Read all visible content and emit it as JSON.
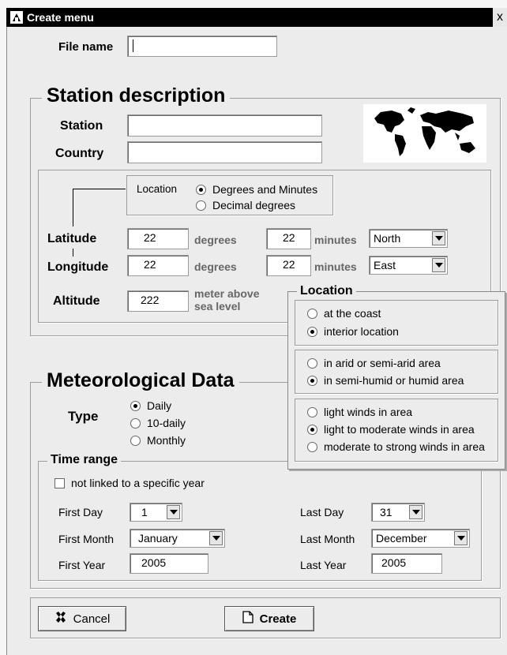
{
  "window": {
    "title": "Create menu",
    "close_label": "x"
  },
  "file": {
    "label": "File name",
    "value": ""
  },
  "station": {
    "heading": "Station description",
    "station_label": "Station",
    "station_value": "",
    "country_label": "Country",
    "country_value": "",
    "map_icon": "world-map-icon"
  },
  "location_format": {
    "label": "Location",
    "options": [
      "Degrees and Minutes",
      "Decimal degrees"
    ],
    "selected": 0
  },
  "coords": {
    "latitude_label": "Latitude",
    "latitude_degrees": "22",
    "latitude_minutes": "22",
    "latitude_dir": "North",
    "longitude_label": "Longitude",
    "longitude_degrees": "22",
    "longitude_minutes": "22",
    "longitude_dir": "East",
    "degrees_unit": "degrees",
    "minutes_unit": "minutes",
    "altitude_label": "Altitude",
    "altitude_value": "222",
    "altitude_unit_line1": "meter above",
    "altitude_unit_line2": "sea level"
  },
  "location_popup": {
    "title": "Location",
    "group1": [
      "at the coast",
      "interior location"
    ],
    "group1_selected": 1,
    "group2": [
      "in arid or semi-arid area",
      "in semi-humid or humid area"
    ],
    "group2_selected": 1,
    "group3": [
      "light winds in area",
      "light to moderate winds in area",
      "moderate to strong winds in area"
    ],
    "group3_selected": 1
  },
  "meteo": {
    "heading": "Meteorological Data",
    "type_label": "Type",
    "type_options": [
      "Daily",
      "10-daily",
      "Monthly"
    ],
    "type_selected": 0,
    "time_range_label": "Time range",
    "not_linked_label": "not linked to a specific year",
    "first_day_label": "First Day",
    "first_day_value": "1",
    "first_month_label": "First Month",
    "first_month_value": "January",
    "first_year_label": "First Year",
    "first_year_value": "2005",
    "last_day_label": "Last Day",
    "last_day_value": "31",
    "last_month_label": "Last Month",
    "last_month_value": "December",
    "last_year_label": "Last Year",
    "last_year_value": "2005"
  },
  "buttons": {
    "cancel": "Cancel",
    "create": "Create"
  }
}
